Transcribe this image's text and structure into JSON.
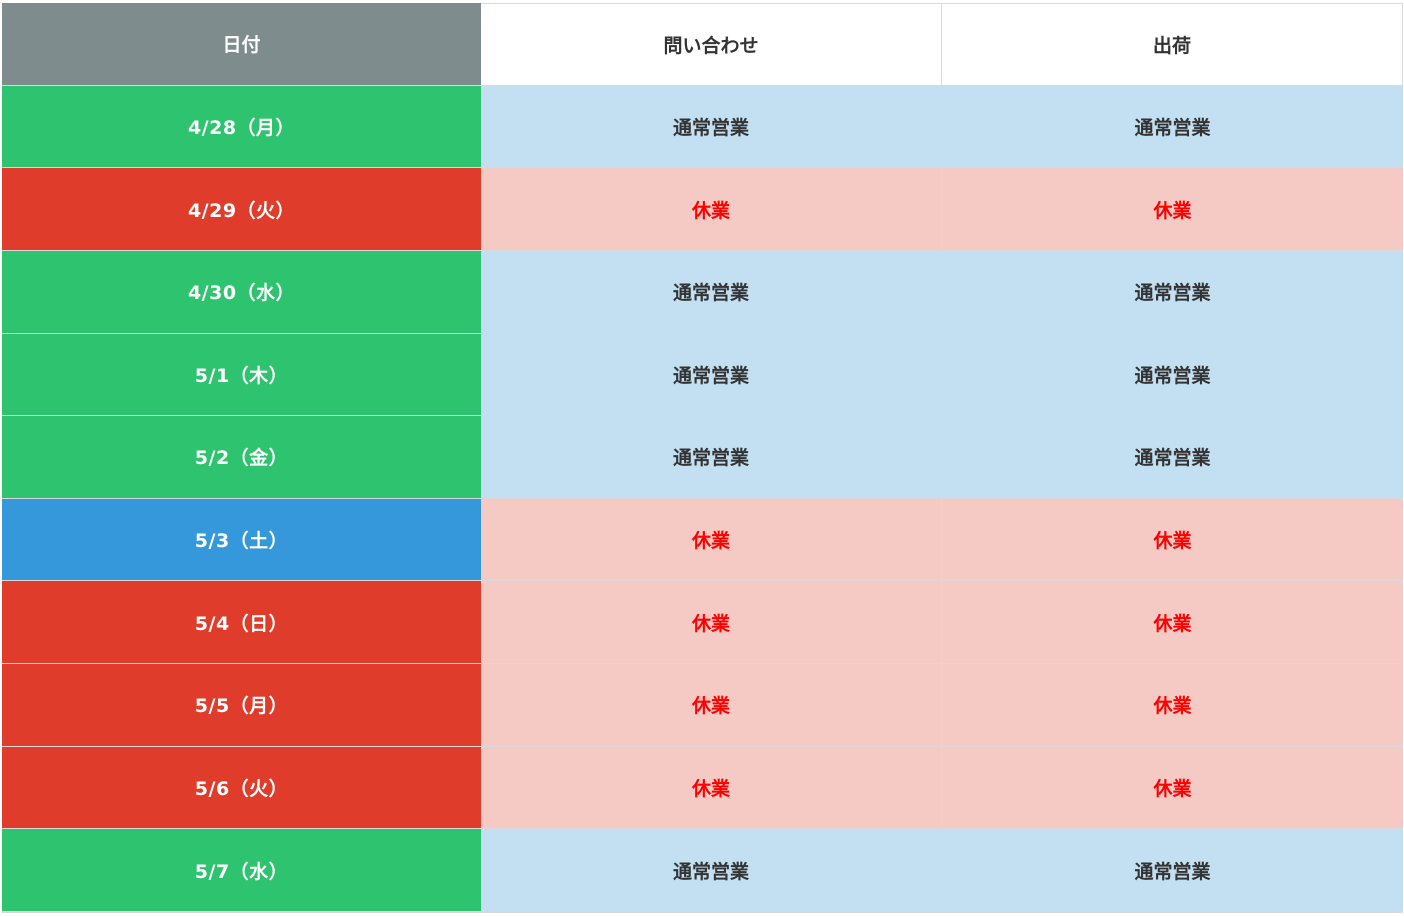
{
  "colors": {
    "header_date_bg": "#7f8c8d",
    "weekday": "#2ec36e",
    "saturday": "#3498db",
    "holiday": "#e03c2b",
    "open_bg": "#c3e0f3",
    "closed_bg": "#f5c9c4",
    "closed_text": "#ff0000"
  },
  "table": {
    "headers": [
      "日付",
      "問い合わせ",
      "出荷"
    ],
    "rows": [
      {
        "date": "4/28（月）",
        "day_type": "weekday",
        "inquiry": "通常営業",
        "shipping": "通常営業",
        "status": "open"
      },
      {
        "date": "4/29（火）",
        "day_type": "holiday",
        "inquiry": "休業",
        "shipping": "休業",
        "status": "closed"
      },
      {
        "date": "4/30（水）",
        "day_type": "weekday",
        "inquiry": "通常営業",
        "shipping": "通常営業",
        "status": "open"
      },
      {
        "date": "5/1（木）",
        "day_type": "weekday",
        "inquiry": "通常営業",
        "shipping": "通常営業",
        "status": "open"
      },
      {
        "date": "5/2（金）",
        "day_type": "weekday",
        "inquiry": "通常営業",
        "shipping": "通常営業",
        "status": "open"
      },
      {
        "date": "5/3（土）",
        "day_type": "saturday",
        "inquiry": "休業",
        "shipping": "休業",
        "status": "closed"
      },
      {
        "date": "5/4（日）",
        "day_type": "holiday",
        "inquiry": "休業",
        "shipping": "休業",
        "status": "closed"
      },
      {
        "date": "5/5（月）",
        "day_type": "holiday",
        "inquiry": "休業",
        "shipping": "休業",
        "status": "closed"
      },
      {
        "date": "5/6（火）",
        "day_type": "holiday",
        "inquiry": "休業",
        "shipping": "休業",
        "status": "closed"
      },
      {
        "date": "5/7（水）",
        "day_type": "weekday",
        "inquiry": "通常営業",
        "shipping": "通常営業",
        "status": "open"
      }
    ]
  }
}
